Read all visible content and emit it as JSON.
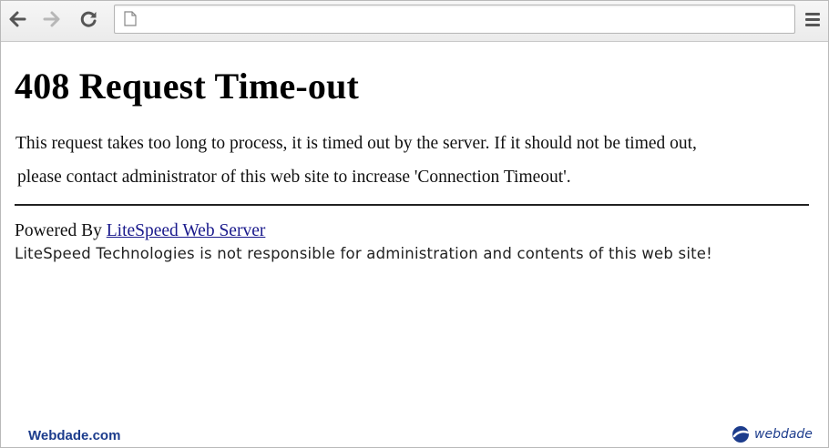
{
  "browser": {
    "url": "",
    "icons": {
      "back": "back-arrow-icon",
      "forward": "forward-arrow-icon",
      "reload": "reload-icon",
      "page": "page-icon",
      "menu": "menu-icon"
    }
  },
  "page": {
    "heading": "408 Request Time-out",
    "message_line1": "This request takes too long to process, it is timed out by the server. If it should not be timed out,",
    "message_line2": "please contact administrator of this web site to increase 'Connection Timeout'.",
    "powered_prefix": "Powered By ",
    "powered_link": "LiteSpeed Web Server",
    "disclaimer": "LiteSpeed Technologies is not responsible for administration and contents of this web site!"
  },
  "watermark": {
    "left_text": "Webdade.com",
    "right_brand": "webdade"
  },
  "colors": {
    "link": "#1a1a8c",
    "watermark": "#1c3c8c"
  }
}
